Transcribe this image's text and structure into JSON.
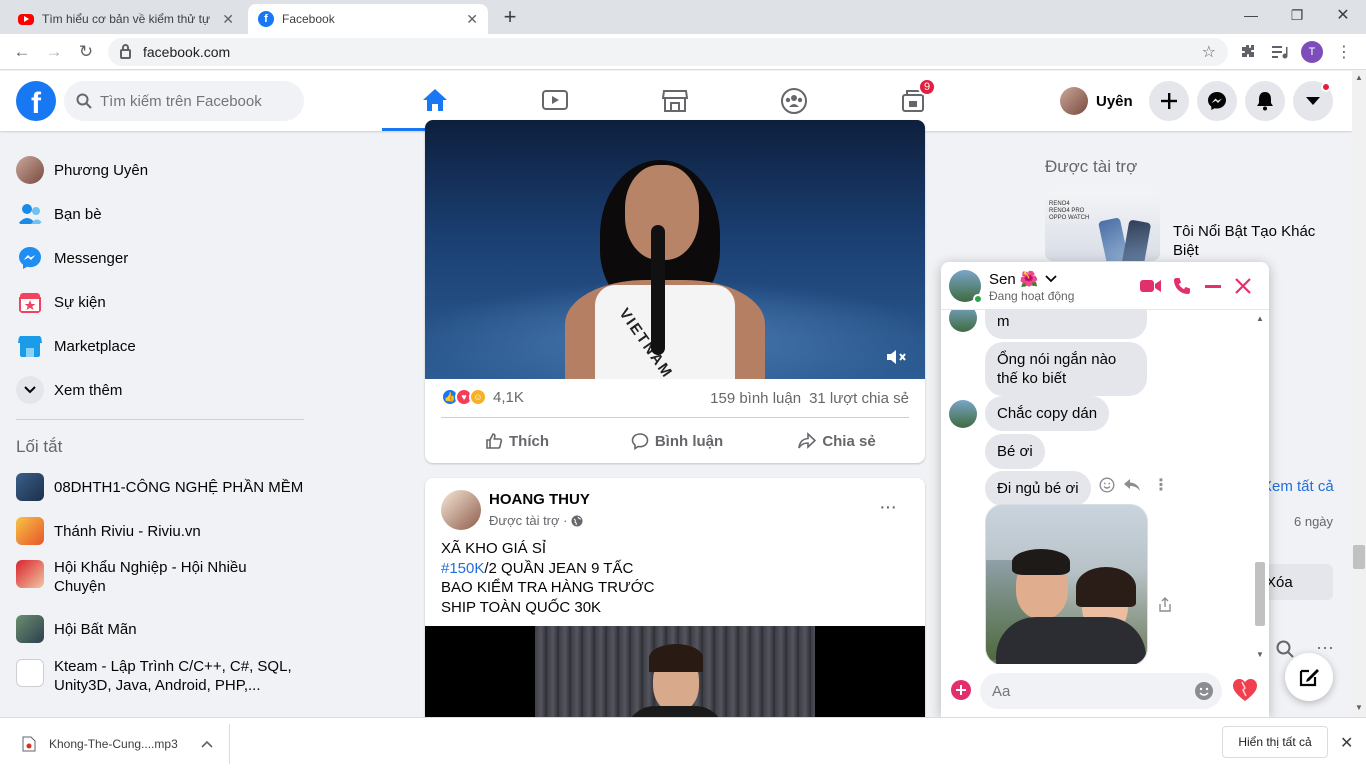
{
  "browser": {
    "tabs": [
      {
        "title": "Tìm hiểu cơ bản về kiểm thử tự đ",
        "favicon": "youtube-icon"
      },
      {
        "title": "Facebook",
        "favicon": "facebook-icon"
      }
    ],
    "new_tab_glyph": "+",
    "url": "facebook.com",
    "profile_initial": "T"
  },
  "fb": {
    "logo": "f",
    "search_placeholder": "Tìm kiếm trên Facebook",
    "notification_badge": "9",
    "user_name": "Uyên",
    "nav_icons": [
      "home-icon",
      "watch-icon",
      "marketplace-icon",
      "groups-icon",
      "gaming-icon"
    ],
    "accent": "#1877f2"
  },
  "sidebar": {
    "items": [
      {
        "label": "Phương Uyên",
        "icon": "profile-avatar"
      },
      {
        "label": "Bạn bè",
        "icon": "friends-icon"
      },
      {
        "label": "Messenger",
        "icon": "messenger-icon"
      },
      {
        "label": "Sự kiện",
        "icon": "events-icon"
      },
      {
        "label": "Marketplace",
        "icon": "marketplace-icon"
      },
      {
        "label": "Xem thêm",
        "icon": "chevron-down-icon"
      }
    ],
    "shortcuts_heading": "Lối tắt",
    "shortcuts": [
      {
        "label": "08DHTH1-CÔNG NGHỆ PHẦN MỀM"
      },
      {
        "label": "Thánh Riviu - Riviu.vn"
      },
      {
        "label": "Hội Khẩu Nghiệp - Hội Nhiều Chuyện"
      },
      {
        "label": "Hội Bất Mãn"
      },
      {
        "label": "Kteam - Lập Trình C/C++, C#, SQL, Unity3D, Java, Android, PHP,..."
      }
    ]
  },
  "post1": {
    "video_caption": "VIETNAM",
    "reactions_count": "4,1K",
    "comments": "159 bình luận",
    "shares": "31 lượt chia sẻ",
    "actions": {
      "like": "Thích",
      "comment": "Bình luận",
      "share": "Chia sẻ"
    }
  },
  "post2": {
    "author": "HOANG THUY",
    "meta": "Được tài trợ ·",
    "more": "···",
    "lines": [
      "XÃ KHO GIÁ SỈ",
      "/2 QUẦN JEAN 9 TẤC",
      "BAO KIỂM TRA HÀNG TRƯỚC",
      "SHIP TOÀN QUỐC 30K"
    ],
    "hashtag": "#150K"
  },
  "right": {
    "sponsored_heading": "Được tài trợ",
    "ad_title": "Tôi Nổi Bật Tạo Khác Biệt",
    "ad_image_lines": [
      "RENO4",
      "RENO4 PRO",
      "OPPO WATCH"
    ],
    "see_all": "Xem tất cả",
    "time": "6 ngày",
    "delete": "Xóa"
  },
  "chat": {
    "name": "Sen 🌺",
    "status": "Đang hoạt động",
    "messages": [
      {
        "text": "m"
      },
      {
        "text": "Ổng nói ngắn nào thế ko biết"
      },
      {
        "text": "Chắc copy dán"
      },
      {
        "text": "Bé ơi"
      },
      {
        "text": "Đi ngủ bé ơi"
      }
    ],
    "input_placeholder": "Aa",
    "accent": "#e3306c"
  },
  "shelf": {
    "file": "Khong-The-Cung....mp3",
    "show_all": "Hiển thị tất cả"
  }
}
